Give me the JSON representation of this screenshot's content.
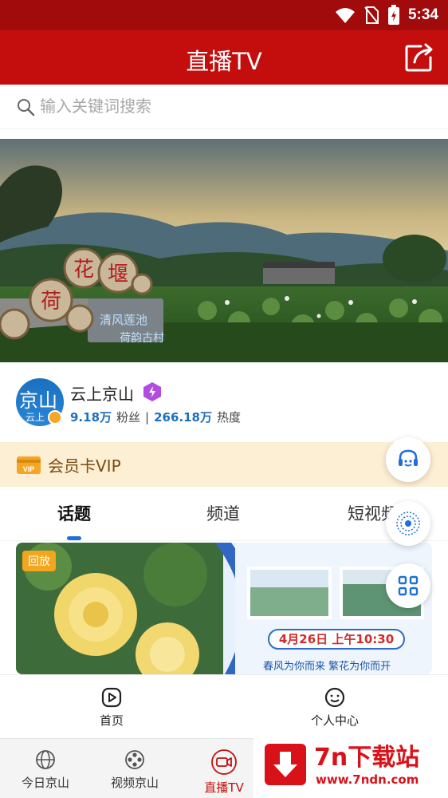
{
  "status_bar": {
    "time": "5:34"
  },
  "header": {
    "title": "直播TV"
  },
  "search": {
    "placeholder": "输入关键词搜索"
  },
  "banner": {
    "sign_chars": [
      "荷",
      "花",
      "堰"
    ],
    "stone_text_1": "清风莲池",
    "stone_text_2": "荷韵古村"
  },
  "profile": {
    "avatar_text": "京山",
    "avatar_sub": "云上",
    "name": "云上京山",
    "fans_count": "9.18万",
    "fans_label": "粉丝",
    "separator": "|",
    "heat_count": "266.18万",
    "heat_label": "热度"
  },
  "vip": {
    "icon_text": "VIP",
    "label": "会员卡VIP"
  },
  "tabs": [
    {
      "label": "话题",
      "active": true
    },
    {
      "label": "频道",
      "active": false
    },
    {
      "label": "短视频",
      "active": false
    }
  ],
  "card": {
    "badge": "回放",
    "date": "4月26日 上午10:30",
    "slogan": "春风为你而来 繁花为你而开"
  },
  "inner_nav": [
    {
      "label": "首页",
      "icon": "play-icon"
    },
    {
      "label": "个人中心",
      "icon": "smile-icon"
    }
  ],
  "outer_nav": [
    {
      "label": "今日京山",
      "icon": "globe-icon",
      "active": false
    },
    {
      "label": "视频京山",
      "icon": "film-reel-icon",
      "active": false
    },
    {
      "label": "直播TV",
      "icon": "camera-icon",
      "active": true
    }
  ],
  "watermark": {
    "title": "7n下载站",
    "url": "www.7ndn.com"
  },
  "colors": {
    "header": "#c40e0e",
    "status_bar": "#a10b0b",
    "accent_blue": "#1e6fd9",
    "vip_bg": "#fdefd4"
  }
}
